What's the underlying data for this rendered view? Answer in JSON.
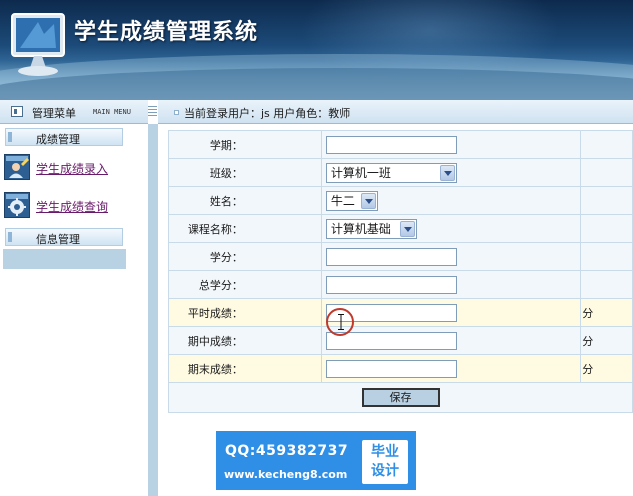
{
  "header": {
    "app_title": "学生成绩管理系统"
  },
  "menu": {
    "title": "管理菜单",
    "subtitle": "MAIN MENU"
  },
  "status": {
    "text": "当前登录用户：js 用户角色：教师"
  },
  "sidebar": {
    "sections": [
      {
        "label": "成绩管理"
      },
      {
        "label": "信息管理"
      }
    ],
    "items": [
      {
        "label": "学生成绩录入",
        "icon": "user-edit-icon"
      },
      {
        "label": "学生成绩查询",
        "icon": "gear-icon"
      }
    ]
  },
  "form": {
    "fields": {
      "term": {
        "label": "学期：",
        "value": ""
      },
      "class": {
        "label": "班级：",
        "value": "计算机一班"
      },
      "name": {
        "label": "姓名：",
        "value": "牛二"
      },
      "course": {
        "label": "课程名称：",
        "value": "计算机基础"
      },
      "credit": {
        "label": "学分：",
        "value": ""
      },
      "total_credit": {
        "label": "总学分：",
        "value": ""
      },
      "regular_score": {
        "label": "平时成绩：",
        "value": "",
        "unit": "分"
      },
      "midterm_score": {
        "label": "期中成绩：",
        "value": "",
        "unit": "分"
      },
      "final_score": {
        "label": "期末成绩：",
        "value": "",
        "unit": "分"
      }
    },
    "save_label": "保存"
  },
  "watermark": {
    "qq": "QQ:459382737",
    "url": "www.kecheng8.com",
    "badge_line1": "毕业",
    "badge_line2": "设计"
  },
  "colors": {
    "banner_dark": "#0d2a4d",
    "accent": "#2f8fe6",
    "highlight_row": "#fffbe3",
    "link": "#6a1a6a"
  }
}
